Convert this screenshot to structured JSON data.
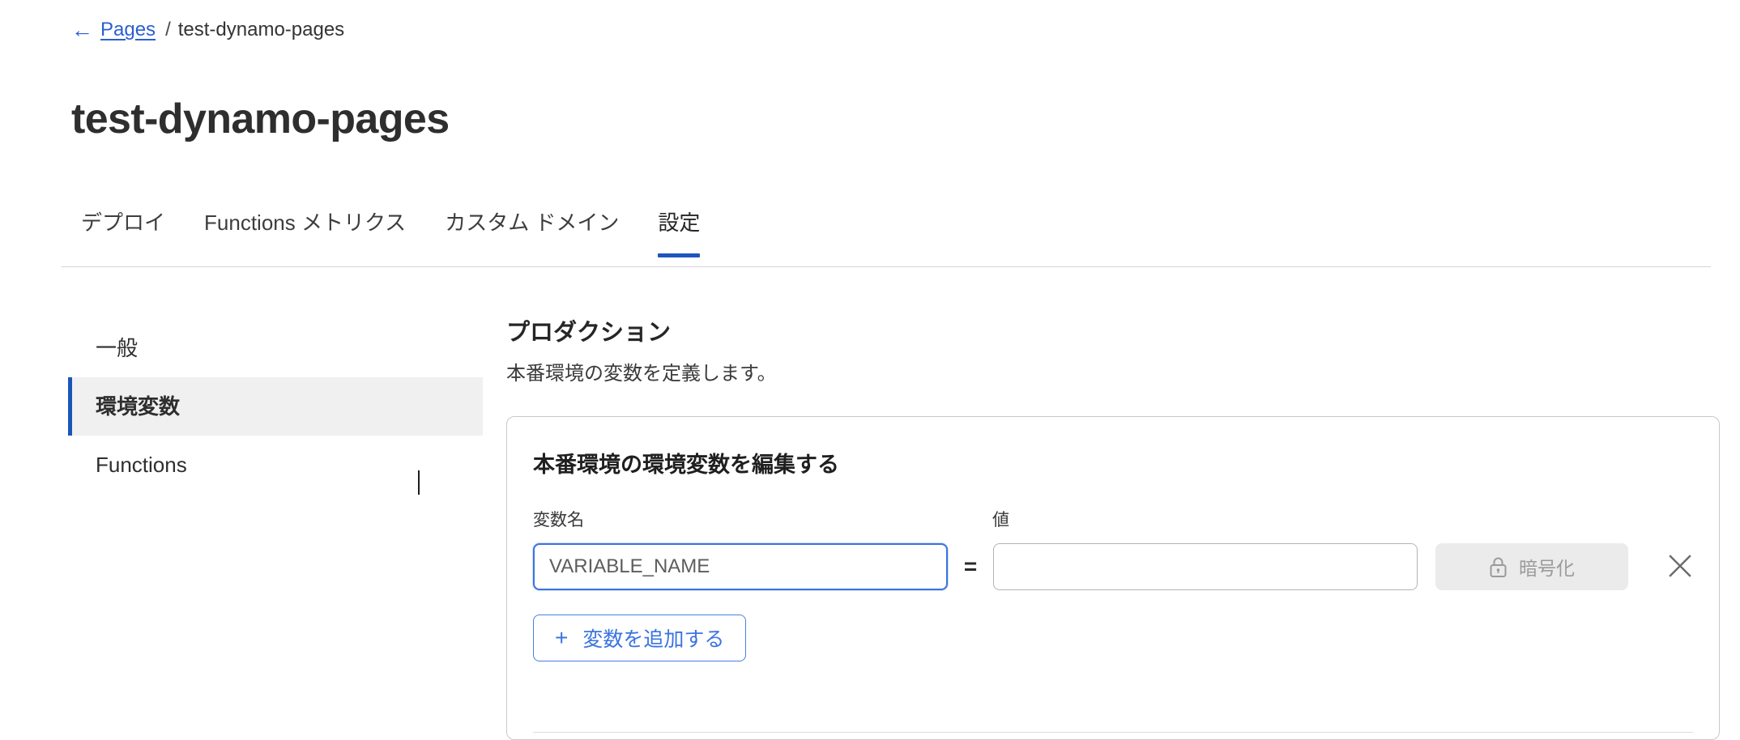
{
  "breadcrumb": {
    "back_arrow": "←",
    "link_label": "Pages",
    "separator": "/",
    "current": "test-dynamo-pages"
  },
  "page_title": "test-dynamo-pages",
  "tabs": [
    {
      "label": "デプロイ",
      "active": false
    },
    {
      "label": "Functions メトリクス",
      "active": false
    },
    {
      "label": "カスタム ドメイン",
      "active": false
    },
    {
      "label": "設定",
      "active": true
    }
  ],
  "subnav": [
    {
      "label": "一般",
      "active": false
    },
    {
      "label": "環境変数",
      "active": true
    },
    {
      "label": "Functions",
      "active": false
    }
  ],
  "main": {
    "section_title": "プロダクション",
    "section_desc": "本番環境の変数を定義します。"
  },
  "card": {
    "title": "本番環境の環境変数を編集する",
    "label_name": "変数名",
    "label_value": "値",
    "name_placeholder": "VARIABLE_NAME",
    "name_value": "",
    "value_placeholder": "",
    "value_value": "",
    "equals_sign": "=",
    "encrypt_label": "暗号化",
    "encrypt_icon": "lock-icon",
    "remove_icon": "close-icon",
    "add_button_label": "変数を追加する",
    "add_button_plus": "+"
  },
  "colors": {
    "accent_blue": "#1f55c0",
    "link_blue": "#2b5fd0",
    "sidebar_active_border": "#1a56b8",
    "sidebar_active_bg": "#f0f0f0",
    "input_focus_border": "#3b74e0",
    "disabled_bg": "#ebebeb",
    "disabled_text": "#9a9a9a",
    "rule": "#d4d4d4"
  }
}
